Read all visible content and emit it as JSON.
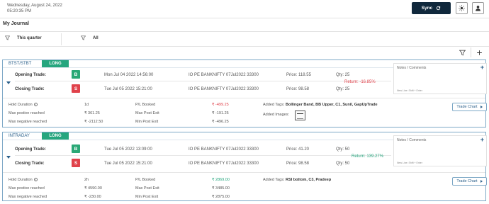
{
  "header": {
    "date": "Wednesday, August 24, 2022",
    "time": "05:20:35 PM",
    "sync_label": "Sync",
    "sync_icon": "refresh-icon",
    "theme_icon": "sun-icon",
    "profile_icon": "user-icon"
  },
  "page_title": "My Journal",
  "filters": {
    "period": "This quarter",
    "scope": "All"
  },
  "colors": {
    "sync_button": "#10283c",
    "long_badge": "#26a67e",
    "buy_badge": "#2aa876",
    "sell_badge": "#e0424b",
    "card_border": "#7da8c6",
    "negative": "#e0424b",
    "positive": "#26a67e"
  },
  "trades": [
    {
      "strategy": "BTST/STBT",
      "side": "LONG",
      "opening": {
        "label": "Opening Trade:",
        "badge": "B",
        "date": "Mon Jul 04 2022 14:56:00",
        "symbol": "IO PE BANKNIFTY 07Jul2022 33300",
        "price": "Price: 118.55",
        "qty": "Qty: 25"
      },
      "closing": {
        "label": "Closing Trade:",
        "badge": "S",
        "date": "Tue Jul 05 2022 15:21:00",
        "symbol": "IO PE BANKNIFTY 07Jul2022 33300",
        "price": "Price: 98.58",
        "qty": "Qty: 25"
      },
      "return": "Return: -16.85%",
      "notes_title": "Notes / Comments",
      "notes_hint": "New Line: Shift + Enter",
      "hold_label": "Hold Duration",
      "hold_value": "1d",
      "max_pos_label": "Max postive reached",
      "max_pos_value": "₹ 361.25",
      "max_neg_label": "Max negative reached",
      "max_neg_value": "₹ -2112.50",
      "pl_label": "P/L Booked",
      "pl_value": "₹ -499.25",
      "max_post_label": "Max Post Exit",
      "max_post_value": "₹ -191.25",
      "min_post_label": "Min Post Exit",
      "min_post_value": "₹ -496.25",
      "tags_label": "Added Tags:",
      "tags_value": "Bollinger Band, BB Upper, C1, Sunil, GapUpTrade",
      "images_label": "Added Images:",
      "chart_button": "Trade Chart"
    },
    {
      "strategy": "INTRADAY",
      "side": "LONG",
      "opening": {
        "label": "Opening Trade:",
        "badge": "B",
        "date": "Tue Jul 05 2022 13:09:00",
        "symbol": "IO PE BANKNIFTY 07Jul2022 33300",
        "price": "Price: 41.20",
        "qty": "Qty: 50"
      },
      "closing": {
        "label": "Closing Trade:",
        "badge": "S",
        "date": "Tue Jul 05 2022 15:21:00",
        "symbol": "IO PE BANKNIFTY 07Jul2022 33300",
        "price": "Price: 98.58",
        "qty": "Qty: 50"
      },
      "return": "Return: 139.27%",
      "notes_title": "Notes / Comments",
      "notes_hint": "New Line: Shift + Enter",
      "hold_label": "Hold Duration",
      "hold_value": "2h",
      "max_pos_label": "Max postive reached",
      "max_pos_value": "₹ 4590.00",
      "max_neg_label": "Max negative reached",
      "max_neg_value": "₹ -230.00",
      "pl_label": "P/L Booked",
      "pl_value": "₹ 2869.00",
      "max_post_label": "Max Post Exit",
      "max_post_value": "₹ 3485.00",
      "min_post_label": "Min Post Exit",
      "min_post_value": "₹ 2875.00",
      "tags_label": "Added Tags:",
      "tags_value": "RSI bottom, C3, Pradeep",
      "chart_button": "Trade Chart"
    }
  ]
}
